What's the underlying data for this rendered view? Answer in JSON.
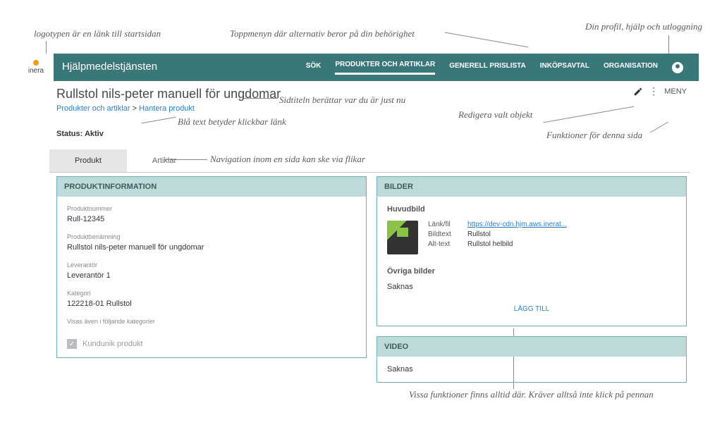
{
  "annotations": {
    "logo": "logotypen är en länk till startsidan",
    "topmenu": "Toppmenyn där alternativ beror på din behörighet",
    "profile": "Din profil, hjälp och utloggning",
    "pagetitle": "Sidtiteln berättar var du är just nu",
    "bluelink": "Blå text betyder klickbar länk",
    "edit": "Redigera valt objekt",
    "pagefunc": "Funktioner för denna sida",
    "tabnav": "Navigation inom en sida kan ske via flikar",
    "always": "Vissa funktioner finns alltid där. Kräver alltså inte klick på pennan"
  },
  "logo_text": "inera",
  "app_title": "Hjälpmedelstjänsten",
  "top_nav": [
    "SÖK",
    "PRODUKTER OCH ARTIKLAR",
    "GENERELL PRISLISTA",
    "INKÖPSAVTAL",
    "ORGANISATION"
  ],
  "page_title": "Rullstol nils-peter manuell för ungdomar",
  "breadcrumb1": "Produkter och artiklar",
  "breadcrumb_sep": " > ",
  "breadcrumb2": "Hantera produkt",
  "status_label": "Status:",
  "status_value": "Aktiv",
  "menu_label": "MENY",
  "tabs": [
    "Produkt",
    "Artiklar"
  ],
  "panel_product_info_title": "PRODUKTINFORMATION",
  "fields": {
    "product_number_label": "Produktnummer",
    "product_number_value": "Rull-12345",
    "product_name_label": "Produktbenämning",
    "product_name_value": "Rullstol nils-peter manuell för ungdomar",
    "supplier_label": "Leverantör",
    "supplier_value": "Leverantör 1",
    "category_label": "Kategori",
    "category_value": "122218-01 Rullstol",
    "also_shown_label": "Visas även i följande kategorier",
    "checkbox_label": "Kundunik produkt"
  },
  "panel_images_title": "BILDER",
  "images": {
    "main_label": "Huvudbild",
    "link_label": "Länk/fil",
    "link_value": "https://dev-cdn.hjm.aws.inerat...",
    "caption_label": "Bildtext",
    "caption_value": "Rullstol",
    "alt_label": "Alt-text",
    "alt_value": "Rullstol helbild",
    "other_label": "Övriga bilder",
    "missing": "Saknas",
    "add": "LÄGG TILL"
  },
  "panel_video_title": "VIDEO",
  "video_missing": "Saknas"
}
